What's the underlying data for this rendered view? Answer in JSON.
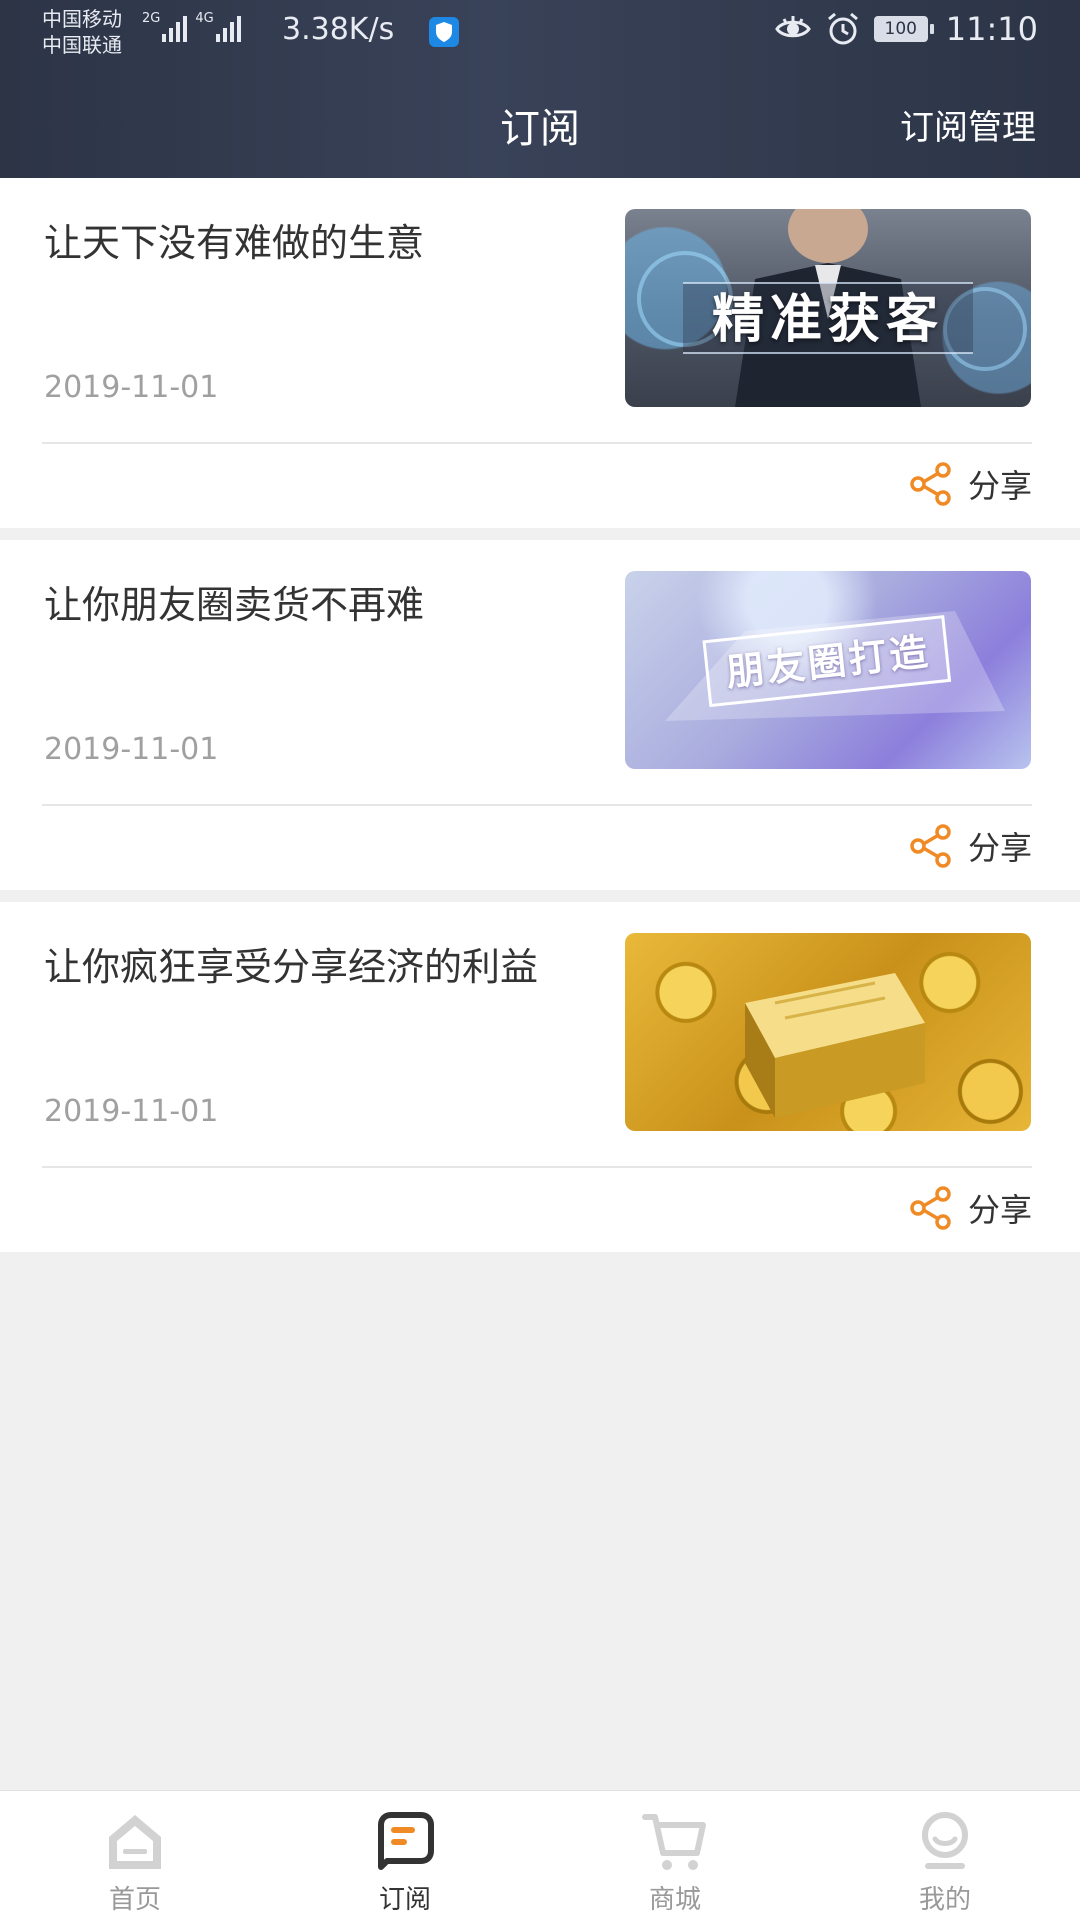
{
  "status_bar": {
    "carrier_1": "中国移动",
    "carrier_2": "中国联通",
    "net_type_1": "2G",
    "net_type_2": "4G",
    "net_speed": "3.38K/s",
    "battery": "100",
    "time": "11:10"
  },
  "header": {
    "title": "订阅",
    "action_label": "订阅管理"
  },
  "articles": [
    {
      "title": "让天下没有难做的生意",
      "date": "2019-11-01",
      "thumb_caption": "精准获客",
      "share_label": "分享"
    },
    {
      "title": "让你朋友圈卖货不再难",
      "date": "2019-11-01",
      "thumb_caption": "朋友圈打造",
      "share_label": "分享"
    },
    {
      "title": "让你疯狂享受分享经济的利益",
      "date": "2019-11-01",
      "share_label": "分享"
    }
  ],
  "tabbar": {
    "items": [
      {
        "label": "首页",
        "icon": "home-icon",
        "active": false
      },
      {
        "label": "订阅",
        "icon": "subscribe-icon",
        "active": true
      },
      {
        "label": "商城",
        "icon": "cart-icon",
        "active": false
      },
      {
        "label": "我的",
        "icon": "profile-icon",
        "active": false
      }
    ]
  },
  "colors": {
    "header_bg": "#2c3446",
    "accent": "#f08a24",
    "inactive_icon": "#cccccc",
    "active_icon": "#333333"
  }
}
